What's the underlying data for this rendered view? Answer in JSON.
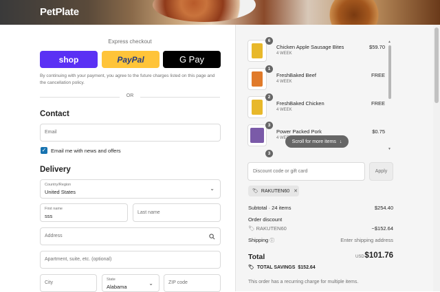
{
  "brand": {
    "logo": "PetPlate"
  },
  "express": {
    "title": "Express checkout",
    "shop_label": "shop",
    "paypal_label": "PayPal",
    "gpay_label": "G Pay",
    "legal": "By continuing with your payment, you agree to the future charges listed on this page and the cancellation policy.",
    "or": "OR"
  },
  "contact": {
    "heading": "Contact",
    "email_placeholder": "Email",
    "newsletter_label": "Email me with news and offers",
    "newsletter_checked": true
  },
  "delivery": {
    "heading": "Delivery",
    "country_label": "Country/Region",
    "country_value": "United States",
    "first_name_label": "First name",
    "first_name_value": "sss",
    "last_name_placeholder": "Last name",
    "address_placeholder": "Address",
    "apartment_placeholder": "Apartment, suite, etc. (optional)",
    "city_placeholder": "City",
    "state_label": "State",
    "state_value": "Alabama",
    "zip_placeholder": "ZIP code"
  },
  "cart": {
    "items": [
      {
        "qty": "6",
        "name": "Chicken Apple Sausage Bites",
        "sub": "4 WEEK",
        "price": "$59.70",
        "color": "#e8b82a"
      },
      {
        "qty": "1",
        "name": "FreshBaked Beef",
        "sub": "4 WEEK",
        "price": "FREE",
        "color": "#e07a2a"
      },
      {
        "qty": "2",
        "name": "FreshBaked Chicken",
        "sub": "4 WEEK",
        "price": "FREE",
        "color": "#e8b82a"
      },
      {
        "qty": "3",
        "name": "Power Packed Pork",
        "sub": "4 WEEK",
        "price": "$0.75",
        "color": "#7a5aa8"
      }
    ],
    "next_qty": "3",
    "scroll_hint": "Scroll for more items"
  },
  "discount": {
    "placeholder": "Discount code or gift card",
    "apply_label": "Apply",
    "applied_code": "RAKUTEN60"
  },
  "summary": {
    "subtotal_label": "Subtotal · 24 items",
    "subtotal_value": "$254.40",
    "order_discount_label": "Order discount",
    "discount_code": "RAKUTEN60",
    "discount_value": "−$152.64",
    "shipping_label": "Shipping",
    "shipping_value": "Enter shipping address",
    "total_label": "Total",
    "currency": "USD",
    "total_value": "$101.76",
    "savings_label": "TOTAL SAVINGS",
    "savings_value": "$152.64",
    "recurring_note": "This order has a recurring charge for multiple items."
  }
}
